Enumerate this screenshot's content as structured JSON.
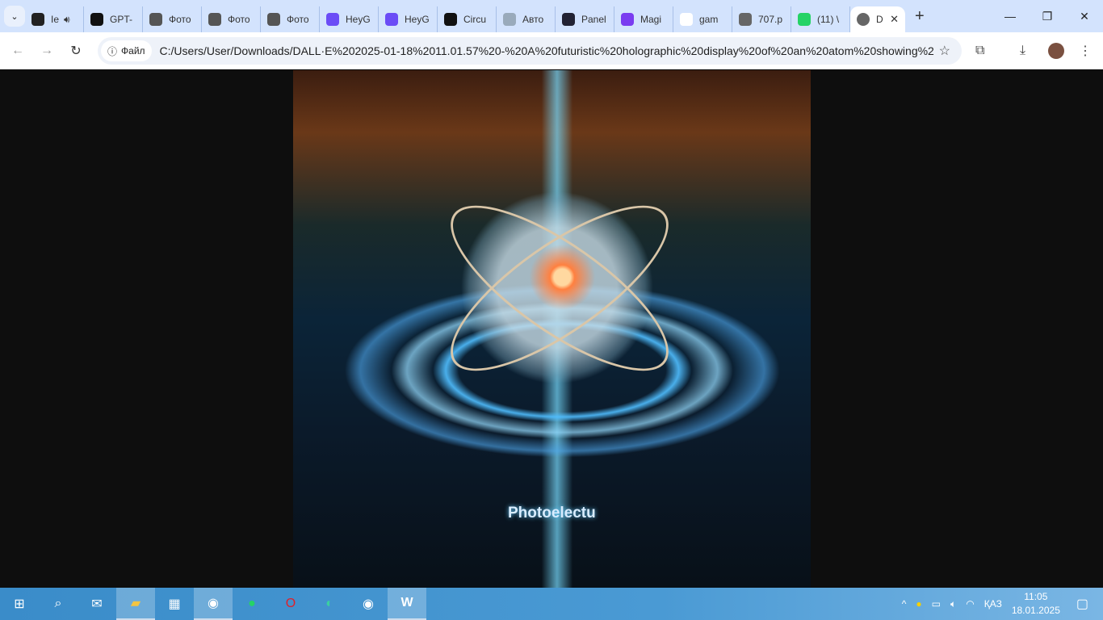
{
  "tabs": [
    {
      "label": "Ie",
      "icon": "rocket-icon",
      "color": "#222",
      "audio": true
    },
    {
      "label": "GPT-",
      "icon": "openai-icon",
      "color": "#111"
    },
    {
      "label": "Фото",
      "icon": "openai-icon",
      "color": "#555"
    },
    {
      "label": "Фото",
      "icon": "openai-icon",
      "color": "#555"
    },
    {
      "label": "Фото",
      "icon": "openai-icon",
      "color": "#555"
    },
    {
      "label": "HeyG",
      "icon": "play-icon",
      "color": "#6b4cf6"
    },
    {
      "label": "HeyG",
      "icon": "play-icon",
      "color": "#6b4cf6"
    },
    {
      "label": "Circu",
      "icon": "phet-icon",
      "color": "#111"
    },
    {
      "label": "Авто",
      "icon": "document-icon",
      "color": "#9ab"
    },
    {
      "label": "Panel",
      "icon": "g-icon",
      "color": "#223"
    },
    {
      "label": "Magi",
      "icon": "m-icon",
      "color": "#7a3cf0"
    },
    {
      "label": "gam",
      "icon": "google-icon",
      "color": "#fff"
    },
    {
      "label": "707.p",
      "icon": "globe-icon",
      "color": "#666"
    },
    {
      "label": "(11) \\",
      "icon": "whatsapp-icon",
      "color": "#25d366"
    }
  ],
  "active_tab": {
    "label": "D",
    "icon": "globe-icon"
  },
  "address": {
    "chip": "Файл",
    "url": "C:/Users/User/Downloads/DALL·E%202025-01-18%2011.01.57%20-%20A%20futuristic%20holographic%20display%20of%20an%20atom%20showing%2..."
  },
  "image": {
    "caption": "Photoelectu"
  },
  "tray": {
    "lang": "ҚАЗ",
    "time": "11:05",
    "date": "18.01.2025"
  }
}
